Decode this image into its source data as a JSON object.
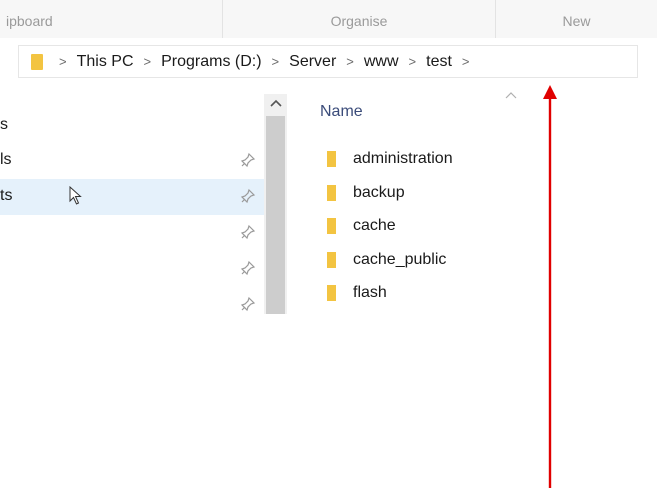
{
  "ribbon": {
    "groups": [
      "ipboard",
      "Organise",
      "New"
    ]
  },
  "address_bar": {
    "crumbs": [
      "This PC",
      "Programs (D:)",
      "Server",
      "www",
      "test"
    ],
    "separator": ">"
  },
  "nav_pane": {
    "items": [
      {
        "label": "s",
        "pinned": false,
        "selected": false
      },
      {
        "label": "ls",
        "pinned": true,
        "selected": false
      },
      {
        "label": "ts",
        "pinned": true,
        "selected": true
      },
      {
        "label": "",
        "pinned": true,
        "selected": false
      },
      {
        "label": "",
        "pinned": true,
        "selected": false
      },
      {
        "label": "",
        "pinned": true,
        "selected": false
      }
    ]
  },
  "file_list": {
    "column_header": "Name",
    "items": [
      {
        "name": "administration",
        "icon": "folder-icon"
      },
      {
        "name": "backup",
        "icon": "folder-icon"
      },
      {
        "name": "cache",
        "icon": "folder-icon"
      },
      {
        "name": "cache_public",
        "icon": "folder-icon"
      },
      {
        "name": "flash",
        "icon": "folder-icon"
      }
    ]
  },
  "colors": {
    "folder": "#f3c441",
    "selection": "#e5f1fb",
    "annotation": "#e00000",
    "header_text": "#3b4c7a"
  }
}
